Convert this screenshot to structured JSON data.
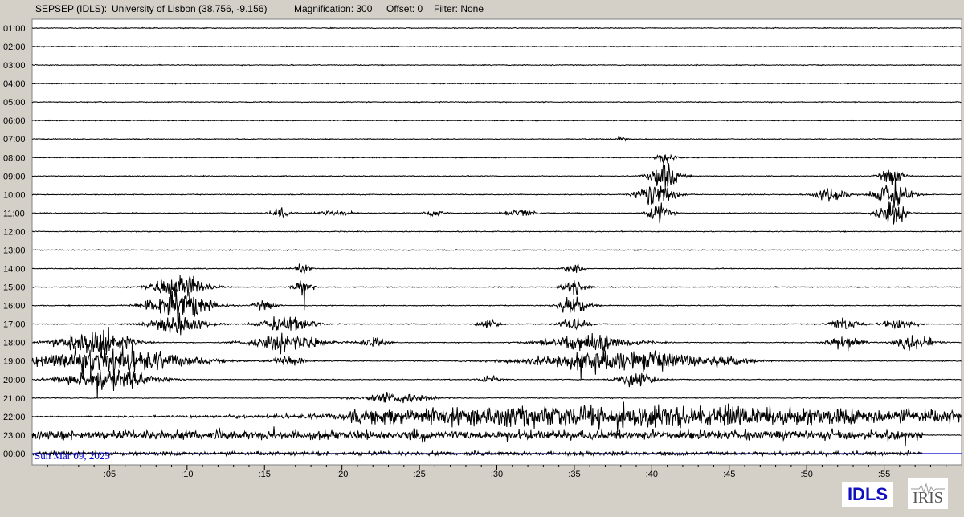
{
  "header": {
    "station": "SEPSEP (IDLS):",
    "location": "University of Lisbon (38.756, -9.156)",
    "magnification": "Magnification: 300",
    "offset": "Offset: 0",
    "filter": "Filter: None"
  },
  "date_label": "Sun Mar 09, 2025",
  "logos": {
    "left": "IDLS",
    "right": "IRIS"
  },
  "colors": {
    "trace": "#000000",
    "background_plot": "#ffffff",
    "frame": "#d4d0c8",
    "date_label": "#0000cc",
    "current_line": "#0000cc"
  },
  "chart_data": {
    "type": "line",
    "title": "",
    "hour_labels": [
      "01:00",
      "02:00",
      "03:00",
      "04:00",
      "05:00",
      "06:00",
      "07:00",
      "08:00",
      "09:00",
      "10:00",
      "11:00",
      "12:00",
      "13:00",
      "14:00",
      "15:00",
      "16:00",
      "17:00",
      "18:00",
      "19:00",
      "20:00",
      "21:00",
      "22:00",
      "23:00",
      "00:00"
    ],
    "minute_ticks": [
      ":05",
      ":10",
      ":15",
      ":20",
      ":25",
      ":30",
      ":35",
      ":40",
      ":45",
      ":50",
      ":55"
    ],
    "minute_tick_values": [
      5,
      10,
      15,
      20,
      25,
      30,
      35,
      40,
      45,
      50,
      55
    ],
    "xlim": [
      0,
      60
    ],
    "events": [
      {
        "hour": "07:00",
        "minute": 38.0,
        "amplitude": 0.4,
        "duration": 0.3
      },
      {
        "hour": "08:00",
        "minute": 41.0,
        "amplitude": 1.2,
        "duration": 0.8
      },
      {
        "hour": "09:00",
        "minute": 40.8,
        "amplitude": 2.2,
        "duration": 1.5
      },
      {
        "hour": "09:00",
        "minute": 55.5,
        "amplitude": 1.5,
        "duration": 1.0
      },
      {
        "hour": "10:00",
        "minute": 40.3,
        "amplitude": 2.0,
        "duration": 2.0
      },
      {
        "hour": "10:00",
        "minute": 51.5,
        "amplitude": 1.3,
        "duration": 1.5
      },
      {
        "hour": "10:00",
        "minute": 55.5,
        "amplitude": 2.0,
        "duration": 2.0
      },
      {
        "hour": "11:00",
        "minute": 16.0,
        "amplitude": 0.9,
        "duration": 0.8
      },
      {
        "hour": "11:00",
        "minute": 19.5,
        "amplitude": 0.4,
        "duration": 2.0
      },
      {
        "hour": "11:00",
        "minute": 26.0,
        "amplitude": 0.7,
        "duration": 0.8
      },
      {
        "hour": "11:00",
        "minute": 31.5,
        "amplitude": 0.6,
        "duration": 1.5
      },
      {
        "hour": "11:00",
        "minute": 40.5,
        "amplitude": 1.6,
        "duration": 1.0
      },
      {
        "hour": "11:00",
        "minute": 55.5,
        "amplitude": 2.0,
        "duration": 1.5
      },
      {
        "hour": "14:00",
        "minute": 17.5,
        "amplitude": 1.2,
        "duration": 0.6
      },
      {
        "hour": "14:00",
        "minute": 35.0,
        "amplitude": 1.2,
        "duration": 0.6
      },
      {
        "hour": "15:00",
        "minute": 9.5,
        "amplitude": 2.2,
        "duration": 3.0
      },
      {
        "hour": "15:00",
        "minute": 17.5,
        "amplitude": 1.3,
        "duration": 0.8
      },
      {
        "hour": "15:00",
        "minute": 35.0,
        "amplitude": 1.5,
        "duration": 1.0
      },
      {
        "hour": "16:00",
        "minute": 9.5,
        "amplitude": 2.4,
        "duration": 3.5
      },
      {
        "hour": "16:00",
        "minute": 15.0,
        "amplitude": 0.8,
        "duration": 1.0
      },
      {
        "hour": "16:00",
        "minute": 35.0,
        "amplitude": 1.6,
        "duration": 1.5
      },
      {
        "hour": "17:00",
        "minute": 9.5,
        "amplitude": 1.6,
        "duration": 3.0
      },
      {
        "hour": "17:00",
        "minute": 16.5,
        "amplitude": 1.2,
        "duration": 3.0
      },
      {
        "hour": "17:00",
        "minute": 29.5,
        "amplitude": 0.8,
        "duration": 1.0
      },
      {
        "hour": "17:00",
        "minute": 35.0,
        "amplitude": 1.0,
        "duration": 1.5
      },
      {
        "hour": "17:00",
        "minute": 52.5,
        "amplitude": 1.0,
        "duration": 1.5
      },
      {
        "hour": "17:00",
        "minute": 56.0,
        "amplitude": 1.0,
        "duration": 1.5
      },
      {
        "hour": "18:00",
        "minute": 4.0,
        "amplitude": 2.3,
        "duration": 4.0
      },
      {
        "hour": "18:00",
        "minute": 16.5,
        "amplitude": 1.6,
        "duration": 4.0
      },
      {
        "hour": "18:00",
        "minute": 22.0,
        "amplitude": 0.8,
        "duration": 1.5
      },
      {
        "hour": "18:00",
        "minute": 36.0,
        "amplitude": 1.5,
        "duration": 5.0
      },
      {
        "hour": "18:00",
        "minute": 52.5,
        "amplitude": 1.4,
        "duration": 1.5
      },
      {
        "hour": "18:00",
        "minute": 57.0,
        "amplitude": 1.3,
        "duration": 2.0
      },
      {
        "hour": "19:00",
        "minute": 5.0,
        "amplitude": 2.4,
        "duration": 9.0
      },
      {
        "hour": "19:00",
        "minute": 16.5,
        "amplitude": 1.0,
        "duration": 1.5
      },
      {
        "hour": "19:00",
        "minute": 38.0,
        "amplitude": 1.8,
        "duration": 10.0
      },
      {
        "hour": "19:00",
        "minute": 45.0,
        "amplitude": 0.6,
        "duration": 2.0
      },
      {
        "hour": "20:00",
        "minute": 5.0,
        "amplitude": 1.8,
        "duration": 5.0
      },
      {
        "hour": "20:00",
        "minute": 29.5,
        "amplitude": 0.6,
        "duration": 1.0
      },
      {
        "hour": "20:00",
        "minute": 39.0,
        "amplitude": 1.4,
        "duration": 2.0
      },
      {
        "hour": "21:00",
        "minute": 23.5,
        "amplitude": 0.8,
        "duration": 4.0
      },
      {
        "hour": "22:00",
        "minute": 39.0,
        "amplitude": 1.2,
        "duration": 38.0
      }
    ],
    "background_noise": [
      {
        "hour": "22:00",
        "start_minute": 20.5,
        "end_minute": 60,
        "amplitude": 0.85
      },
      {
        "hour": "23:00",
        "start_minute": 0,
        "end_minute": 57.5,
        "amplitude": 0.9
      },
      {
        "hour": "00:00",
        "start_minute": 0,
        "end_minute": 57.5,
        "amplitude": 0.35
      }
    ],
    "current_time_minute": 57.5
  }
}
